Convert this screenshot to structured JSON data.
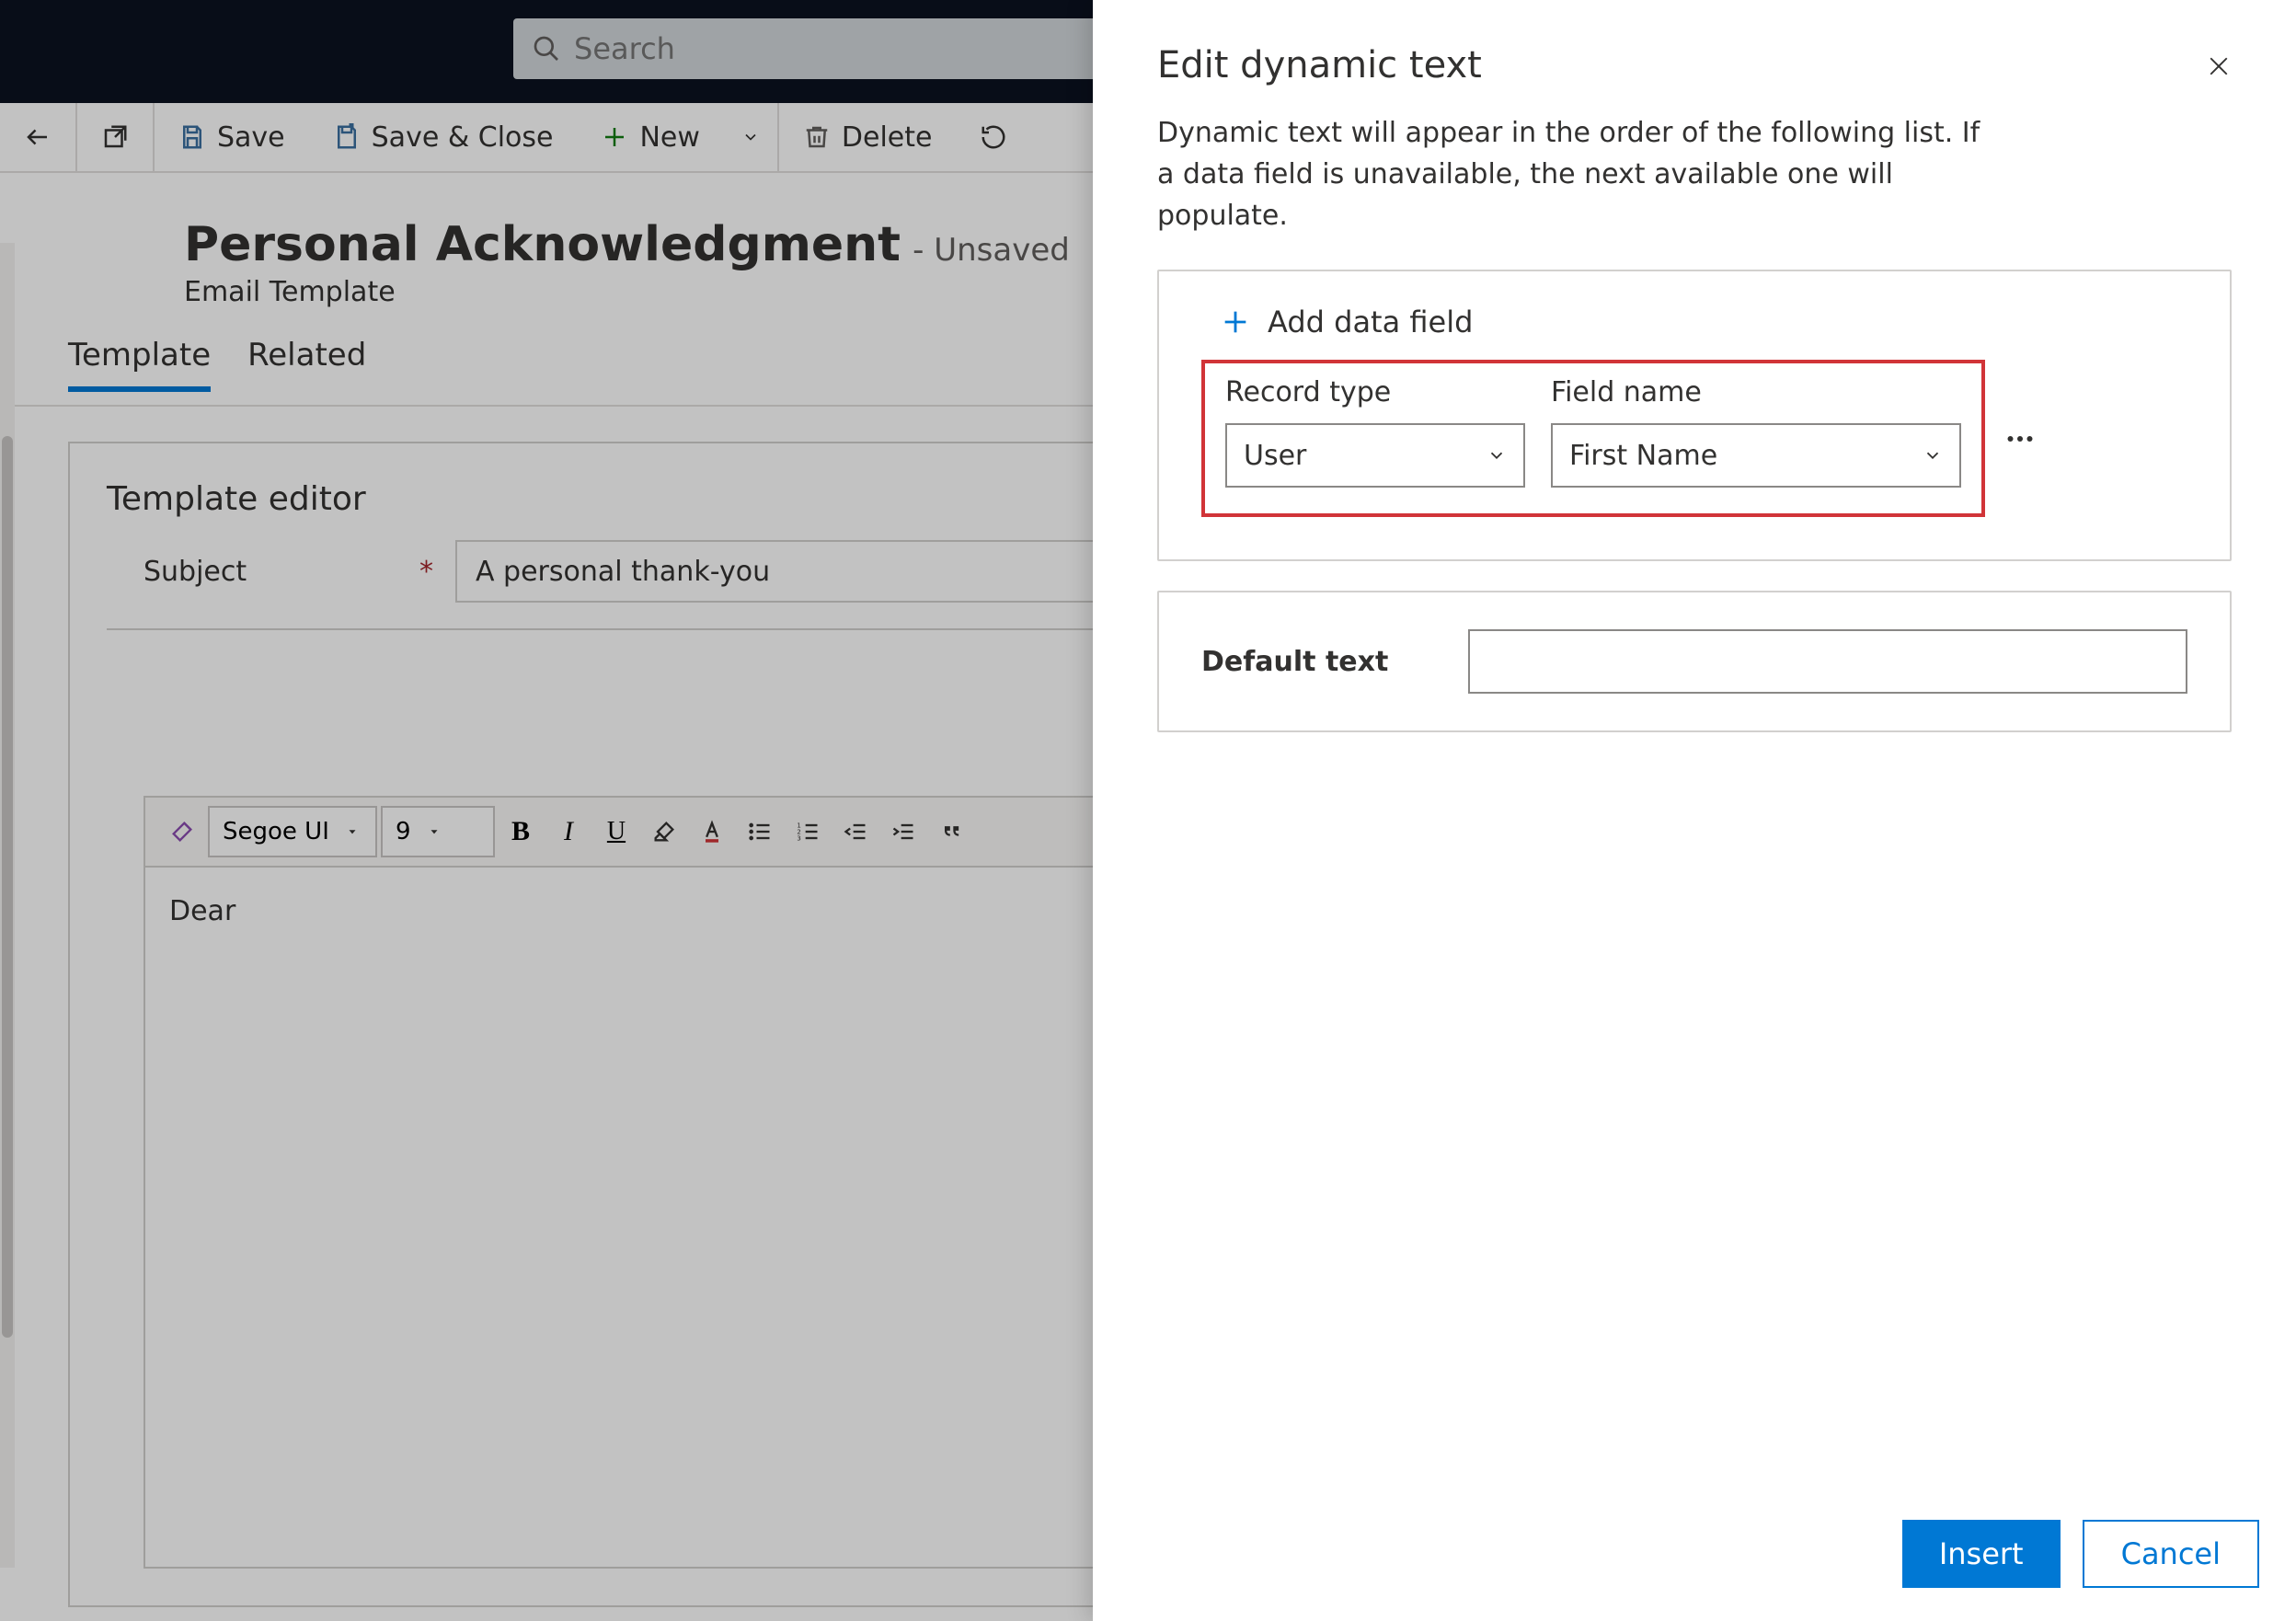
{
  "header": {
    "search_placeholder": "Search"
  },
  "commandbar": {
    "save": "Save",
    "save_close": "Save & Close",
    "new": "New",
    "delete": "Delete"
  },
  "page": {
    "title": "Personal Acknowledgment",
    "status": "- Unsaved",
    "subtitle": "Email Template"
  },
  "tabs": {
    "template": "Template",
    "related": "Related"
  },
  "editor": {
    "heading": "Template editor",
    "subject_label": "Subject",
    "subject_value": "A personal thank-you",
    "rte_font": "Segoe UI",
    "rte_size": "9",
    "body_text": "Dear"
  },
  "panel": {
    "title": "Edit dynamic text",
    "description": "Dynamic text will appear in the order of the following list. If a data field is unavailable, the next available one will populate.",
    "add_field": "Add data field",
    "record_type_label": "Record type",
    "field_name_label": "Field name",
    "record_type_value": "User",
    "field_name_value": "First Name",
    "default_text_label": "Default text",
    "default_text_value": "",
    "insert": "Insert",
    "cancel": "Cancel"
  }
}
